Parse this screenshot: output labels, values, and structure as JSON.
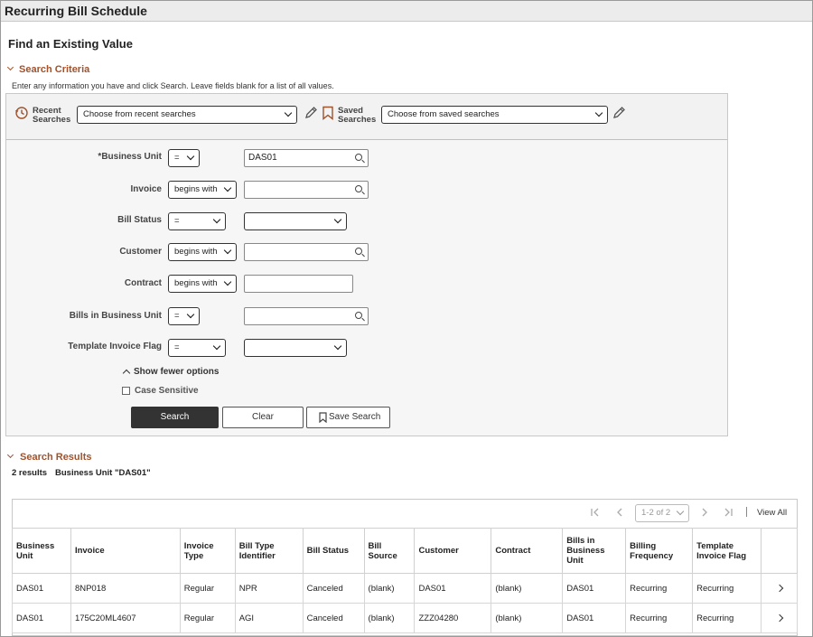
{
  "window_title": "Recurring Bill Schedule",
  "page_heading": "Find an Existing Value",
  "search_criteria": {
    "heading": "Search Criteria",
    "instructions": "Enter any information you have and click Search. Leave fields blank for a list of all values.",
    "recent_searches_label_1": "Recent",
    "recent_searches_label_2": "Searches",
    "recent_searches_select": "Choose from recent searches",
    "saved_searches_label_1": "Saved",
    "saved_searches_label_2": "Searches",
    "saved_searches_select": "Choose from saved searches",
    "fields": [
      {
        "label": "*Business Unit",
        "operator": "=",
        "value": "DAS01",
        "type": "lookup"
      },
      {
        "label": "Invoice",
        "operator": "begins with",
        "value": "",
        "type": "lookup"
      },
      {
        "label": "Bill Status",
        "operator": "=",
        "value": "",
        "type": "select"
      },
      {
        "label": "Customer",
        "operator": "begins with",
        "value": "",
        "type": "lookup"
      },
      {
        "label": "Contract",
        "operator": "begins with",
        "value": "",
        "type": "text"
      },
      {
        "label": "Bills in Business Unit",
        "operator": "=",
        "value": "",
        "type": "lookup"
      },
      {
        "label": "Template Invoice Flag",
        "operator": "=",
        "value": "",
        "type": "select"
      }
    ],
    "show_fewer": "Show fewer options",
    "case_sensitive": "Case Sensitive",
    "search_button": "Search",
    "clear_button": "Clear",
    "save_search_button": "Save Search"
  },
  "search_results": {
    "heading": "Search Results",
    "count": "2 results",
    "filter": "Business Unit \"DAS01\"",
    "pagination": "1-2 of 2",
    "view_all": "View All",
    "columns": [
      "Business Unit",
      "Invoice",
      "Invoice Type",
      "Bill Type Identifier",
      "Bill Status",
      "Bill Source",
      "Customer",
      "Contract",
      "Bills in Business Unit",
      "Billing Frequency",
      "Template Invoice Flag"
    ],
    "rows": [
      [
        "DAS01",
        "8NP018",
        "Regular",
        "NPR",
        "Canceled",
        "(blank)",
        "DAS01",
        "(blank)",
        "DAS01",
        "Recurring",
        "Recurring"
      ],
      [
        "DAS01",
        "175C20ML4607",
        "Regular",
        "AGI",
        "Canceled",
        "(blank)",
        "ZZZ04280",
        "(blank)",
        "DAS01",
        "Recurring",
        "Recurring"
      ]
    ]
  },
  "colors": {
    "accent": "#a0522d",
    "primary_button": "#333333"
  }
}
